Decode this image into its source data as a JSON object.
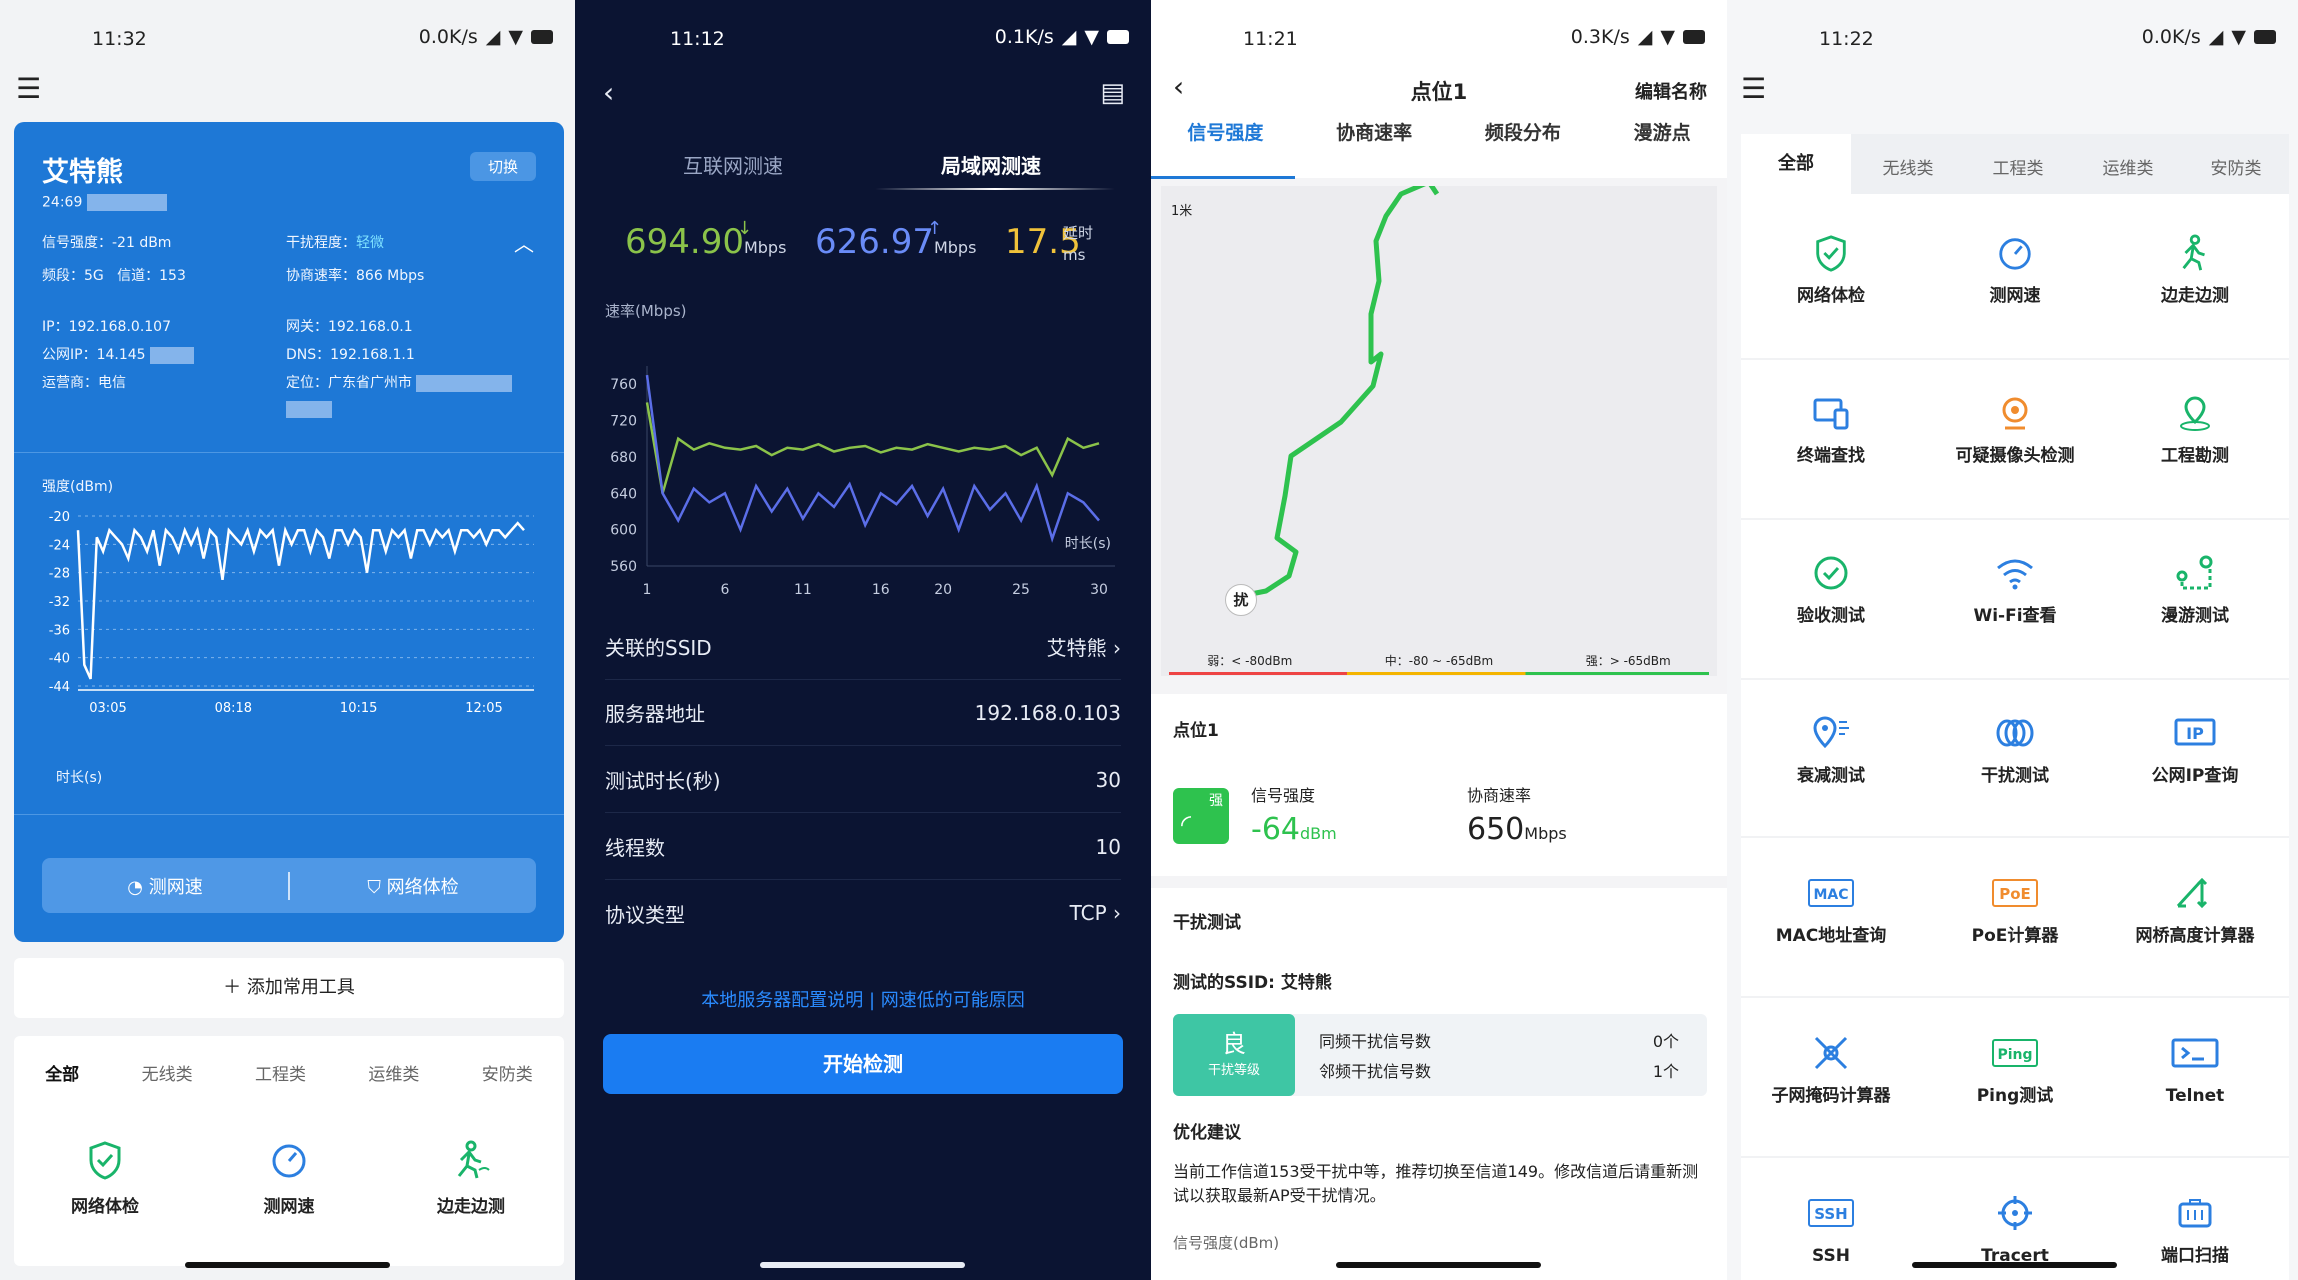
{
  "p1": {
    "status": {
      "time": "11:32",
      "speed": "0.0K/s"
    },
    "card": {
      "title": "艾特熊",
      "switch": "切换",
      "id": "24:69",
      "signal_label": "信号强度：-21 dBm",
      "interf_label": "干扰程度：",
      "interf_value": "轻微",
      "band": "频段：5G",
      "channel": "信道：153",
      "rate": "协商速率：866 Mbps",
      "ip": "IP：192.168.0.107",
      "gateway": "网关：192.168.0.1",
      "pubip": "公网IP：14.145",
      "dns": "DNS：192.168.1.1",
      "isp": "运营商：电信",
      "loc": "定位：广东省广州市",
      "chart_label": "强度(dBm)",
      "xlabel": "时长(s)",
      "btn_speed": "测网速",
      "btn_check": "网络体检"
    },
    "add_tool": "添加常用工具",
    "tabs": [
      "全部",
      "无线类",
      "工程类",
      "运维类",
      "安防类"
    ],
    "tools": [
      "网络体检",
      "测网速",
      "边走边测"
    ]
  },
  "p2": {
    "status": {
      "time": "11:12",
      "speed": "0.1K/s"
    },
    "tabs": [
      "互联网测速",
      "局域网测速"
    ],
    "down": "694.90",
    "down_unit": "Mbps",
    "up": "626.97",
    "up_unit": "Mbps",
    "latency": "17.5",
    "latency_label": "延时",
    "latency_unit": "ms",
    "chart_ylabel": "速率(Mbps)",
    "chart_xlabel": "时长(s)",
    "rows": [
      {
        "k": "关联的SSID",
        "v": "艾特熊"
      },
      {
        "k": "服务器地址",
        "v": "192.168.0.103"
      },
      {
        "k": "测试时长(秒)",
        "v": "30"
      },
      {
        "k": "线程数",
        "v": "10"
      },
      {
        "k": "协议类型",
        "v": "TCP"
      }
    ],
    "links": "本地服务器配置说明 | 网速低的可能原因",
    "start": "开始检测"
  },
  "p3": {
    "status": {
      "time": "11:21",
      "speed": "0.3K/s"
    },
    "title": "点位1",
    "edit": "编辑名称",
    "tabs": [
      "信号强度",
      "协商速率",
      "频段分布",
      "漫游点"
    ],
    "scale": "1米",
    "interf_marker": "扰",
    "legend": [
      "弱：< -80dBm",
      "中：-80 ~ -65dBm",
      "强：> -65dBm"
    ],
    "point": "点位1",
    "sig_label": "信号强度",
    "sig_value": "-64",
    "sig_unit": "dBm",
    "sig_badge": "强",
    "rate_label": "协商速率",
    "rate_value": "650",
    "rate_unit": "Mbps",
    "interf_title": "干扰测试",
    "ssid": "测试的SSID: 艾特熊",
    "grade": "良",
    "grade_label": "干扰等级",
    "same": "同频干扰信号数",
    "same_v": "0个",
    "adj": "邻频干扰信号数",
    "adj_v": "1个",
    "advice_title": "优化建议",
    "advice": "当前工作信道153受干扰中等，推荐切换至信道149。修改信道后请重新测试以获取最新AP受干扰情况。",
    "bottom": "信号强度(dBm)"
  },
  "p4": {
    "status": {
      "time": "11:22",
      "speed": "0.0K/s"
    },
    "tabs": [
      "全部",
      "无线类",
      "工程类",
      "运维类",
      "安防类"
    ],
    "tools": [
      "网络体检",
      "测网速",
      "边走边测",
      "终端查找",
      "可疑摄像头检测",
      "工程勘测",
      "验收测试",
      "Wi-Fi查看",
      "漫游测试",
      "衰减测试",
      "干扰测试",
      "公网IP查询",
      "MAC地址查询",
      "PoE计算器",
      "网桥高度计算器",
      "子网掩码计算器",
      "Ping测试",
      "Telnet",
      "SSH",
      "Tracert",
      "端口扫描"
    ],
    "icon_text": {
      "mac": "MAC",
      "poe": "PoE",
      "ping": "Ping",
      "ssh": "SSH",
      "ip": "IP"
    }
  },
  "chart_data": [
    {
      "type": "line",
      "title": "",
      "ylabel": "强度(dBm)",
      "xlabel": "时长(s)",
      "ylim": [
        -44,
        -20
      ],
      "yticks": [
        -20,
        -24,
        -28,
        -32,
        -36,
        -40,
        -44
      ],
      "xticks": [
        "03:05",
        "08:18",
        "10:15",
        "12:05"
      ],
      "series": [
        {
          "values": [
            -22,
            -41,
            -43,
            -23,
            -25,
            -22,
            -23,
            -24,
            -26,
            -22,
            -23,
            -25,
            -22,
            -27,
            -22,
            -23,
            -25,
            -22,
            -24,
            -22,
            -26,
            -22,
            -23,
            -29,
            -22,
            -23,
            -24,
            -22,
            -25,
            -22,
            -23,
            -22,
            -27,
            -22,
            -24,
            -22,
            -22,
            -25,
            -22,
            -23,
            -26,
            -22,
            -22,
            -24,
            -22,
            -23,
            -28,
            -22,
            -22,
            -25,
            -22,
            -23,
            -22,
            -26,
            -22,
            -22,
            -24,
            -22,
            -23,
            -22,
            -25,
            -22,
            -22,
            -23,
            -22,
            -24,
            -22,
            -22,
            -23,
            -22,
            -21,
            -22
          ]
        }
      ]
    },
    {
      "type": "line",
      "title": "",
      "ylabel": "速率(Mbps)",
      "xlabel": "时长(s)",
      "ylim": [
        560,
        780
      ],
      "yticks": [
        760,
        720,
        680,
        640,
        600,
        560
      ],
      "xticks": [
        "1",
        "6",
        "11",
        "16",
        "20",
        "25",
        "30"
      ],
      "series": [
        {
          "name": "下载",
          "color": "#8bc34a",
          "values": [
            740,
            640,
            700,
            688,
            695,
            690,
            688,
            692,
            682,
            690,
            688,
            694,
            686,
            690,
            692,
            685,
            690,
            688,
            694,
            690,
            686,
            690,
            688,
            692,
            682,
            690,
            660,
            700,
            690,
            695
          ]
        },
        {
          "name": "上传",
          "color": "#5b6ee8",
          "values": [
            770,
            640,
            610,
            645,
            630,
            640,
            600,
            648,
            620,
            645,
            612,
            640,
            625,
            650,
            605,
            640,
            628,
            648,
            615,
            645,
            600,
            648,
            622,
            640,
            610,
            648,
            590,
            640,
            630,
            610
          ]
        }
      ]
    }
  ]
}
